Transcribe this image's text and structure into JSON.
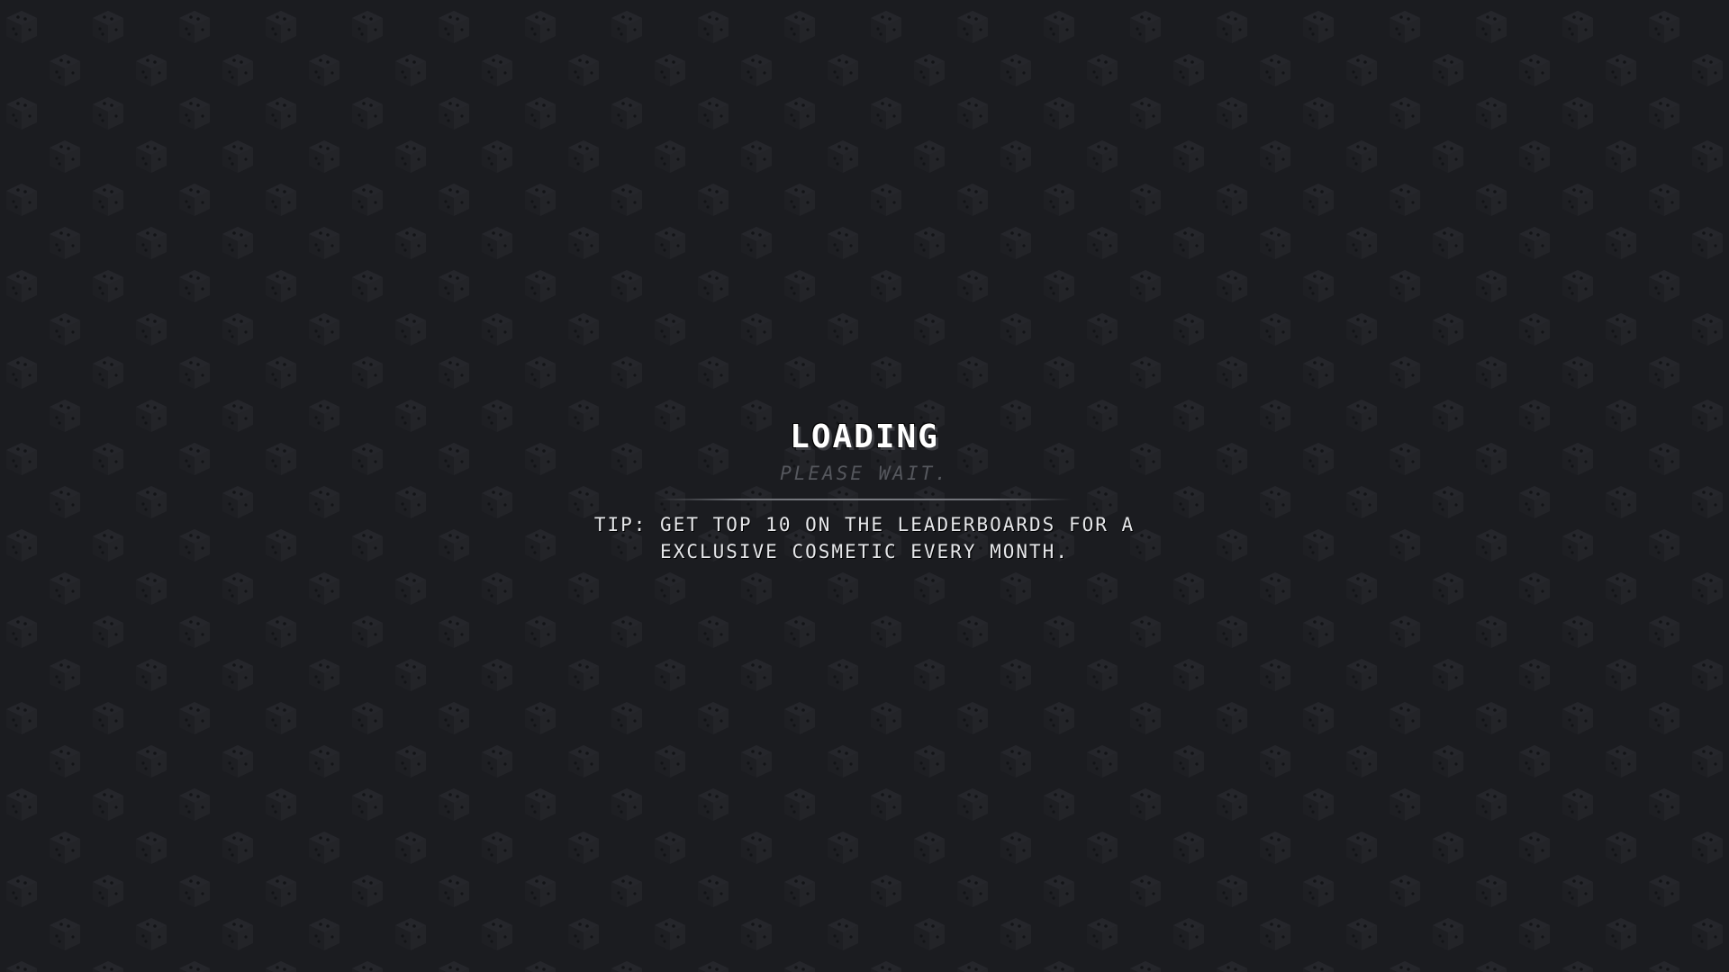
{
  "screen": {
    "background_color": "#1b1c20",
    "pattern_icon": "dice-icon",
    "pattern_color": "#202126"
  },
  "loading": {
    "title": "LOADING",
    "subtitle": "PLEASE WAIT.",
    "tip": "TIP: GET TOP 10 ON THE LEADERBOARDS FOR A EXCLUSIVE COSMETIC EVERY MONTH."
  },
  "colors": {
    "title": "#ffffff",
    "subtitle": "#55575d",
    "tip": "#e6e7ea",
    "divider": "#7a7c82"
  }
}
